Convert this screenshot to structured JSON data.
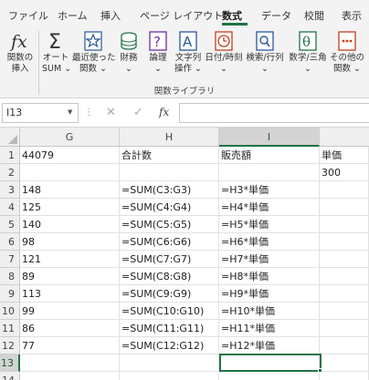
{
  "tabs": [
    {
      "label": "ファイル",
      "active": false
    },
    {
      "label": "ホーム",
      "active": false
    },
    {
      "label": "挿入",
      "active": false
    },
    {
      "label": "ページ レイアウト",
      "active": false
    },
    {
      "label": "数式",
      "active": true
    },
    {
      "label": "データ",
      "active": false
    },
    {
      "label": "校閲",
      "active": false
    },
    {
      "label": "表示",
      "active": false
    }
  ],
  "ribbon": {
    "buttons": [
      {
        "icon": "function-fx-icon",
        "line1": "関数の",
        "line2": "挿入"
      },
      {
        "icon": "autosum-sigma-icon",
        "line1": "オート",
        "line2": "SUM ⌄"
      },
      {
        "icon": "star-recently-used-icon",
        "line1": "最近使った",
        "line2": "関数 ⌄"
      },
      {
        "icon": "financial-coins-icon",
        "line1": "財務",
        "line2": "⌄"
      },
      {
        "icon": "logical-question-icon",
        "line1": "論理",
        "line2": "⌄"
      },
      {
        "icon": "text-a-icon",
        "line1": "文字列",
        "line2": "操作 ⌄"
      },
      {
        "icon": "clock-datetime-icon",
        "line1": "日付/時刻",
        "line2": "⌄"
      },
      {
        "icon": "lookup-magnifier-icon",
        "line1": "検索/行列",
        "line2": "⌄"
      },
      {
        "icon": "math-theta-icon",
        "line1": "数学/三角",
        "line2": "⌄"
      },
      {
        "icon": "more-functions-icon",
        "line1": "その他の",
        "line2": "関数 ⌄"
      }
    ],
    "group_label": "関数ライブラリ"
  },
  "formula_bar": {
    "name_box": "I13",
    "formula": ""
  },
  "grid": {
    "columns": [
      "G",
      "H",
      "I"
    ],
    "selected_column": "I",
    "rows": [
      {
        "n": "1",
        "G": "44079",
        "H": "合計数",
        "I": "販売額",
        "J": "単価"
      },
      {
        "n": "2",
        "G": "",
        "H": "",
        "I": "",
        "J": "300"
      },
      {
        "n": "3",
        "G": "148",
        "H": "=SUM(C3:G3)",
        "I": "=H3*単価",
        "J": ""
      },
      {
        "n": "4",
        "G": "125",
        "H": "=SUM(C4:G4)",
        "I": "=H4*単価",
        "J": ""
      },
      {
        "n": "5",
        "G": "140",
        "H": "=SUM(C5:G5)",
        "I": "=H5*単価",
        "J": ""
      },
      {
        "n": "6",
        "G": "98",
        "H": "=SUM(C6:G6)",
        "I": "=H6*単価",
        "J": ""
      },
      {
        "n": "7",
        "G": "121",
        "H": "=SUM(C7:G7)",
        "I": "=H7*単価",
        "J": ""
      },
      {
        "n": "8",
        "G": "89",
        "H": "=SUM(C8:G8)",
        "I": "=H8*単価",
        "J": ""
      },
      {
        "n": "9",
        "G": "113",
        "H": "=SUM(C9:G9)",
        "I": "=H9*単価",
        "J": ""
      },
      {
        "n": "10",
        "G": "99",
        "H": "=SUM(C10:G10)",
        "I": "=H10*単価",
        "J": ""
      },
      {
        "n": "11",
        "G": "86",
        "H": "=SUM(C11:G11)",
        "I": "=H11*単価",
        "J": ""
      },
      {
        "n": "12",
        "G": "77",
        "H": "=SUM(C12:G12)",
        "I": "=H12*単価",
        "J": ""
      },
      {
        "n": "13",
        "G": "",
        "H": "",
        "I": "",
        "J": ""
      },
      {
        "n": "14",
        "G": "",
        "H": "",
        "I": "",
        "J": ""
      }
    ],
    "selected_row": "13"
  },
  "colors": {
    "accent": "#217346",
    "ribbon_bg": "#f3f3f3",
    "header_bg": "#efefef"
  }
}
